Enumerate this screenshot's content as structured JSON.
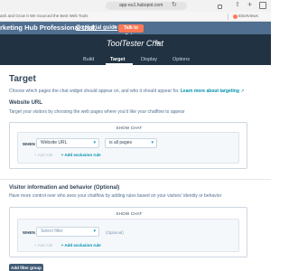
{
  "browser": {
    "url": "app-eu1.hubspot.com",
    "bookmarks_text": "ash and Grow It  We Sourced the Best Web Tools",
    "bookmark_right": "ElsetViews"
  },
  "banner": {
    "text": "rketing Hub Professional trial.",
    "link": "Go to trial guide",
    "button": "Talk to Sales"
  },
  "header": {
    "title": "ToolTester Chat",
    "tabs": [
      "Build",
      "Target",
      "Display",
      "Options"
    ],
    "active_tab": "Target"
  },
  "target": {
    "heading": "Target",
    "description": "Choose which pages the chat widget should appear on, and who it should appear for.",
    "learn_more": "Learn more about targeting"
  },
  "website_url": {
    "heading": "Website URL",
    "description": "Target your visitors by choosing the web pages where you'd like your chatflow to appear",
    "card_label": "SHOW CHAT",
    "when": "WHEN",
    "field": "Website URL",
    "operator": "is all pages",
    "add_rule": "+ Add rule",
    "add_exclusion": "+ Add exclusion rule"
  },
  "visitor_info": {
    "heading": "Visitor information and behavior (Optional)",
    "description": "Have more control over who sees your chatflow by adding rules based on your visitors' identity or behavior",
    "card_label": "SHOW CHAT",
    "when": "WHEN",
    "field_placeholder": "Select filter",
    "optional_hint": "(Optional)",
    "add_rule": "+ Add rule",
    "add_exclusion": "+ Add exclusion rule"
  },
  "footer": {
    "add_filter_group": "Add filter group"
  },
  "colors": {
    "header_bg": "#213343",
    "banner_bg": "#516f90",
    "accent": "#ff7a59",
    "link": "#0091ae"
  }
}
